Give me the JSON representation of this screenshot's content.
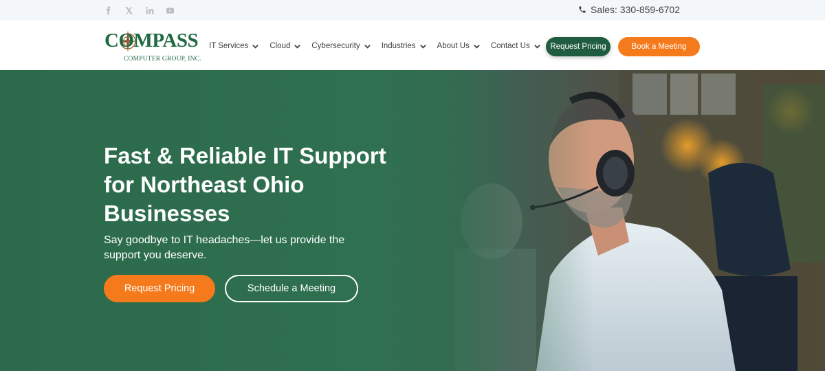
{
  "topbar": {
    "social_icons": [
      "facebook-icon",
      "x-icon",
      "linkedin-icon",
      "youtube-icon"
    ],
    "sales_label": "Sales: 330-859-6702"
  },
  "header": {
    "logo": {
      "main": "COMPASS",
      "sub": "COMPUTER GROUP, INC."
    },
    "nav": [
      {
        "label": "IT Services"
      },
      {
        "label": "Cloud"
      },
      {
        "label": "Cybersecurity"
      },
      {
        "label": "Industries"
      },
      {
        "label": "About Us"
      },
      {
        "label": "Contact Us"
      }
    ],
    "request_pricing_label": "Request Pricing",
    "book_meeting_label": "Book a Meeting"
  },
  "hero": {
    "title": "Fast & Reliable IT Support for Northeast Ohio Businesses",
    "subtitle": "Say goodbye to IT headaches—let us provide the support you deserve.",
    "primary_button": "Request Pricing",
    "secondary_button": "Schedule a Meeting"
  },
  "colors": {
    "brand_green": "#1f6a43",
    "dark_green_button": "#1f5c40",
    "hero_green": "#2f7050",
    "accent_orange": "#f47a1b",
    "topbar_bg": "#f4f7f9"
  }
}
